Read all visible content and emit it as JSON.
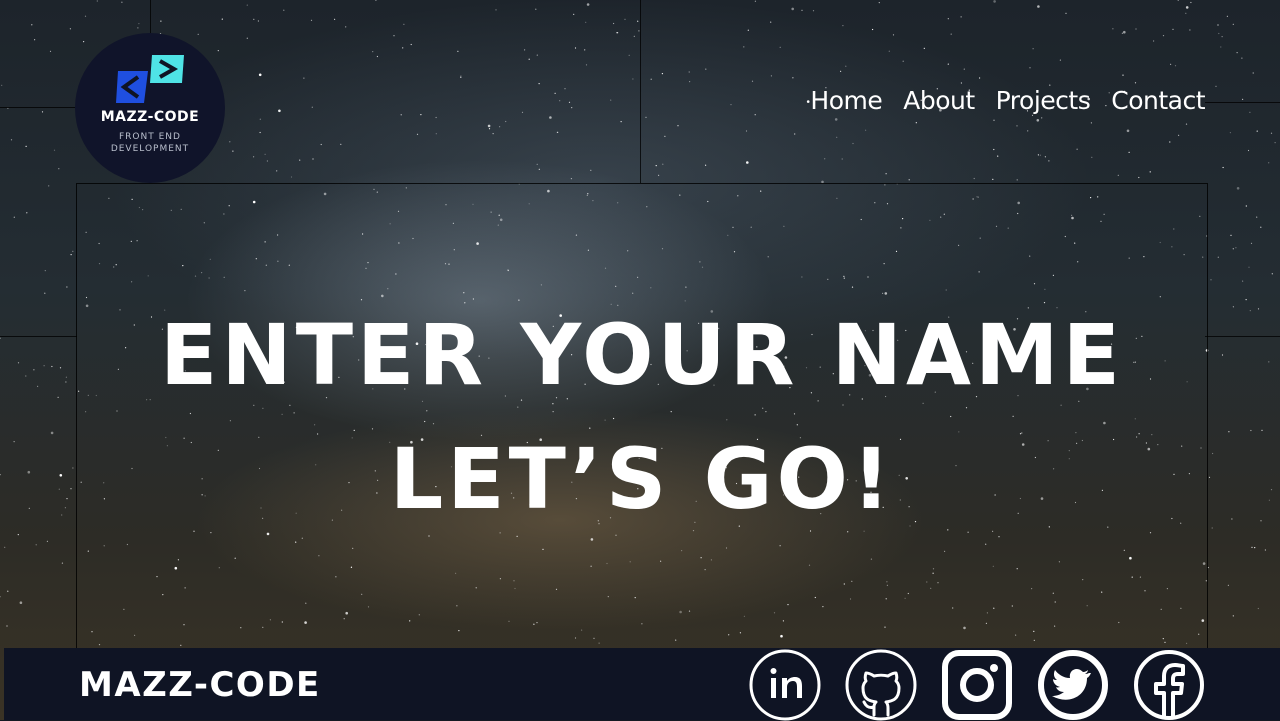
{
  "brand": {
    "name": "MAZZ-CODE",
    "tagline_line1": "FRONT END",
    "tagline_line2": "DEVELOPMENT"
  },
  "nav": [
    {
      "label": "Home"
    },
    {
      "label": "About"
    },
    {
      "label": "Projects"
    },
    {
      "label": "Contact"
    }
  ],
  "hero": {
    "line1": "ENTER YOUR NAME",
    "line2": "LET’S GO!"
  },
  "footer": {
    "brand": "MAZZ-CODE",
    "socials": [
      {
        "icon": "linkedin-icon"
      },
      {
        "icon": "github-icon"
      },
      {
        "icon": "instagram-icon"
      },
      {
        "icon": "twitter-icon"
      },
      {
        "icon": "facebook-icon"
      }
    ]
  },
  "colors": {
    "footer_bg": "#0f1424",
    "logo_bg": "#10142a",
    "logo_blue": "#1f4fe0",
    "logo_cyan": "#4fe3e6",
    "text": "#ffffff"
  }
}
